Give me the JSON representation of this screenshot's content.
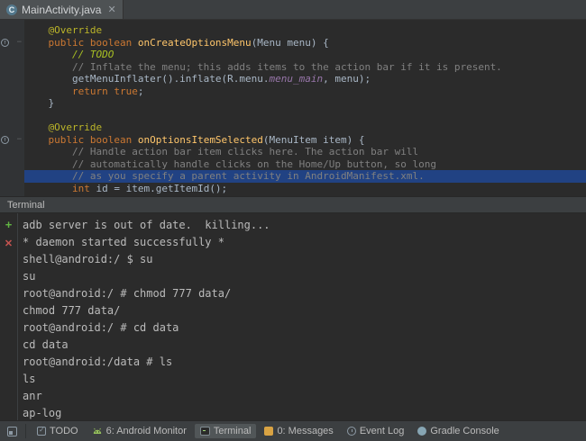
{
  "colors": {
    "editor-bg": "#2b2b2b",
    "gutter-bg": "#313335",
    "panel-bg": "#3c3f41",
    "tab-bg": "#4e5254",
    "selection": "#214283",
    "fg": "#a9b7c6",
    "annotation": "#bbb529",
    "keyword": "#cc7832",
    "method": "#ffc66b",
    "comment": "#808080",
    "todo": "#a8c023",
    "field": "#9876aa",
    "terminal-fg": "#bbbbbb",
    "plus-green": "#62b543",
    "close-red": "#c75450"
  },
  "tab": {
    "label": "MainActivity.java",
    "icon": "class-icon",
    "close_icon": "close-icon"
  },
  "editor": {
    "lines": [
      {
        "tokens": [
          {
            "t": "    ",
            "c": "plain"
          },
          {
            "t": "@Override",
            "c": "annotation"
          }
        ]
      },
      {
        "gutter": "override-icon",
        "fold": true,
        "tokens": [
          {
            "t": "    ",
            "c": "plain"
          },
          {
            "t": "public boolean ",
            "c": "keyword"
          },
          {
            "t": "onCreateOptionsMenu",
            "c": "method"
          },
          {
            "t": "(Menu menu) {",
            "c": "plain"
          }
        ]
      },
      {
        "tokens": [
          {
            "t": "        ",
            "c": "plain"
          },
          {
            "t": "// TODO",
            "c": "todo"
          }
        ]
      },
      {
        "tokens": [
          {
            "t": "        ",
            "c": "plain"
          },
          {
            "t": "// Inflate the menu; this adds items to the action bar if it is present.",
            "c": "comment"
          }
        ]
      },
      {
        "tokens": [
          {
            "t": "        getMenuInflater().inflate(R.menu.",
            "c": "plain"
          },
          {
            "t": "menu_main",
            "c": "field"
          },
          {
            "t": ", menu);",
            "c": "plain"
          }
        ]
      },
      {
        "tokens": [
          {
            "t": "        ",
            "c": "plain"
          },
          {
            "t": "return true",
            "c": "keyword"
          },
          {
            "t": ";",
            "c": "plain"
          }
        ]
      },
      {
        "tokens": [
          {
            "t": "    }",
            "c": "plain"
          }
        ]
      },
      {
        "tokens": []
      },
      {
        "tokens": [
          {
            "t": "    ",
            "c": "plain"
          },
          {
            "t": "@Override",
            "c": "annotation"
          }
        ]
      },
      {
        "gutter": "override-icon",
        "fold": true,
        "tokens": [
          {
            "t": "    ",
            "c": "plain"
          },
          {
            "t": "public boolean ",
            "c": "keyword"
          },
          {
            "t": "onOptionsItemSelected",
            "c": "method"
          },
          {
            "t": "(MenuItem item) {",
            "c": "plain"
          }
        ]
      },
      {
        "tokens": [
          {
            "t": "        ",
            "c": "plain"
          },
          {
            "t": "// Handle action bar item clicks here. The action bar will",
            "c": "comment"
          }
        ]
      },
      {
        "tokens": [
          {
            "t": "        ",
            "c": "plain"
          },
          {
            "t": "// automatically handle clicks on the Home/Up button, so long",
            "c": "comment"
          }
        ]
      },
      {
        "selected": true,
        "tokens": [
          {
            "t": "        ",
            "c": "plain"
          },
          {
            "t": "// as you specify a parent activity in AndroidManifest.xml.",
            "c": "comment"
          }
        ]
      },
      {
        "tokens": [
          {
            "t": "        ",
            "c": "plain"
          },
          {
            "t": "int ",
            "c": "keyword"
          },
          {
            "t": "id = item.getItemId();",
            "c": "plain"
          }
        ]
      }
    ]
  },
  "terminal": {
    "title": "Terminal",
    "toolbar": [
      {
        "icon": "add-session-icon"
      },
      {
        "icon": "close-session-icon"
      }
    ],
    "lines": [
      "adb server is out of date.  killing...",
      "* daemon started successfully *",
      "shell@android:/ $ su",
      "su",
      "root@android:/ # chmod 777 data/",
      "chmod 777 data/",
      "root@android:/ # cd data",
      "cd data",
      "root@android:/data # ls",
      "ls",
      "anr",
      "ap-log"
    ]
  },
  "statusbar": {
    "items": [
      {
        "label": "TODO",
        "icon": "todo-icon",
        "active": false
      },
      {
        "label": "6: Android Monitor",
        "icon": "android-icon",
        "active": false
      },
      {
        "label": "Terminal",
        "icon": "terminal-icon",
        "active": true
      },
      {
        "label": "0: Messages",
        "icon": "messages-icon",
        "active": false
      },
      {
        "label": "Event Log",
        "icon": "event-log-icon",
        "active": false
      },
      {
        "label": "Gradle Console",
        "icon": "gradle-icon",
        "active": false
      }
    ]
  }
}
